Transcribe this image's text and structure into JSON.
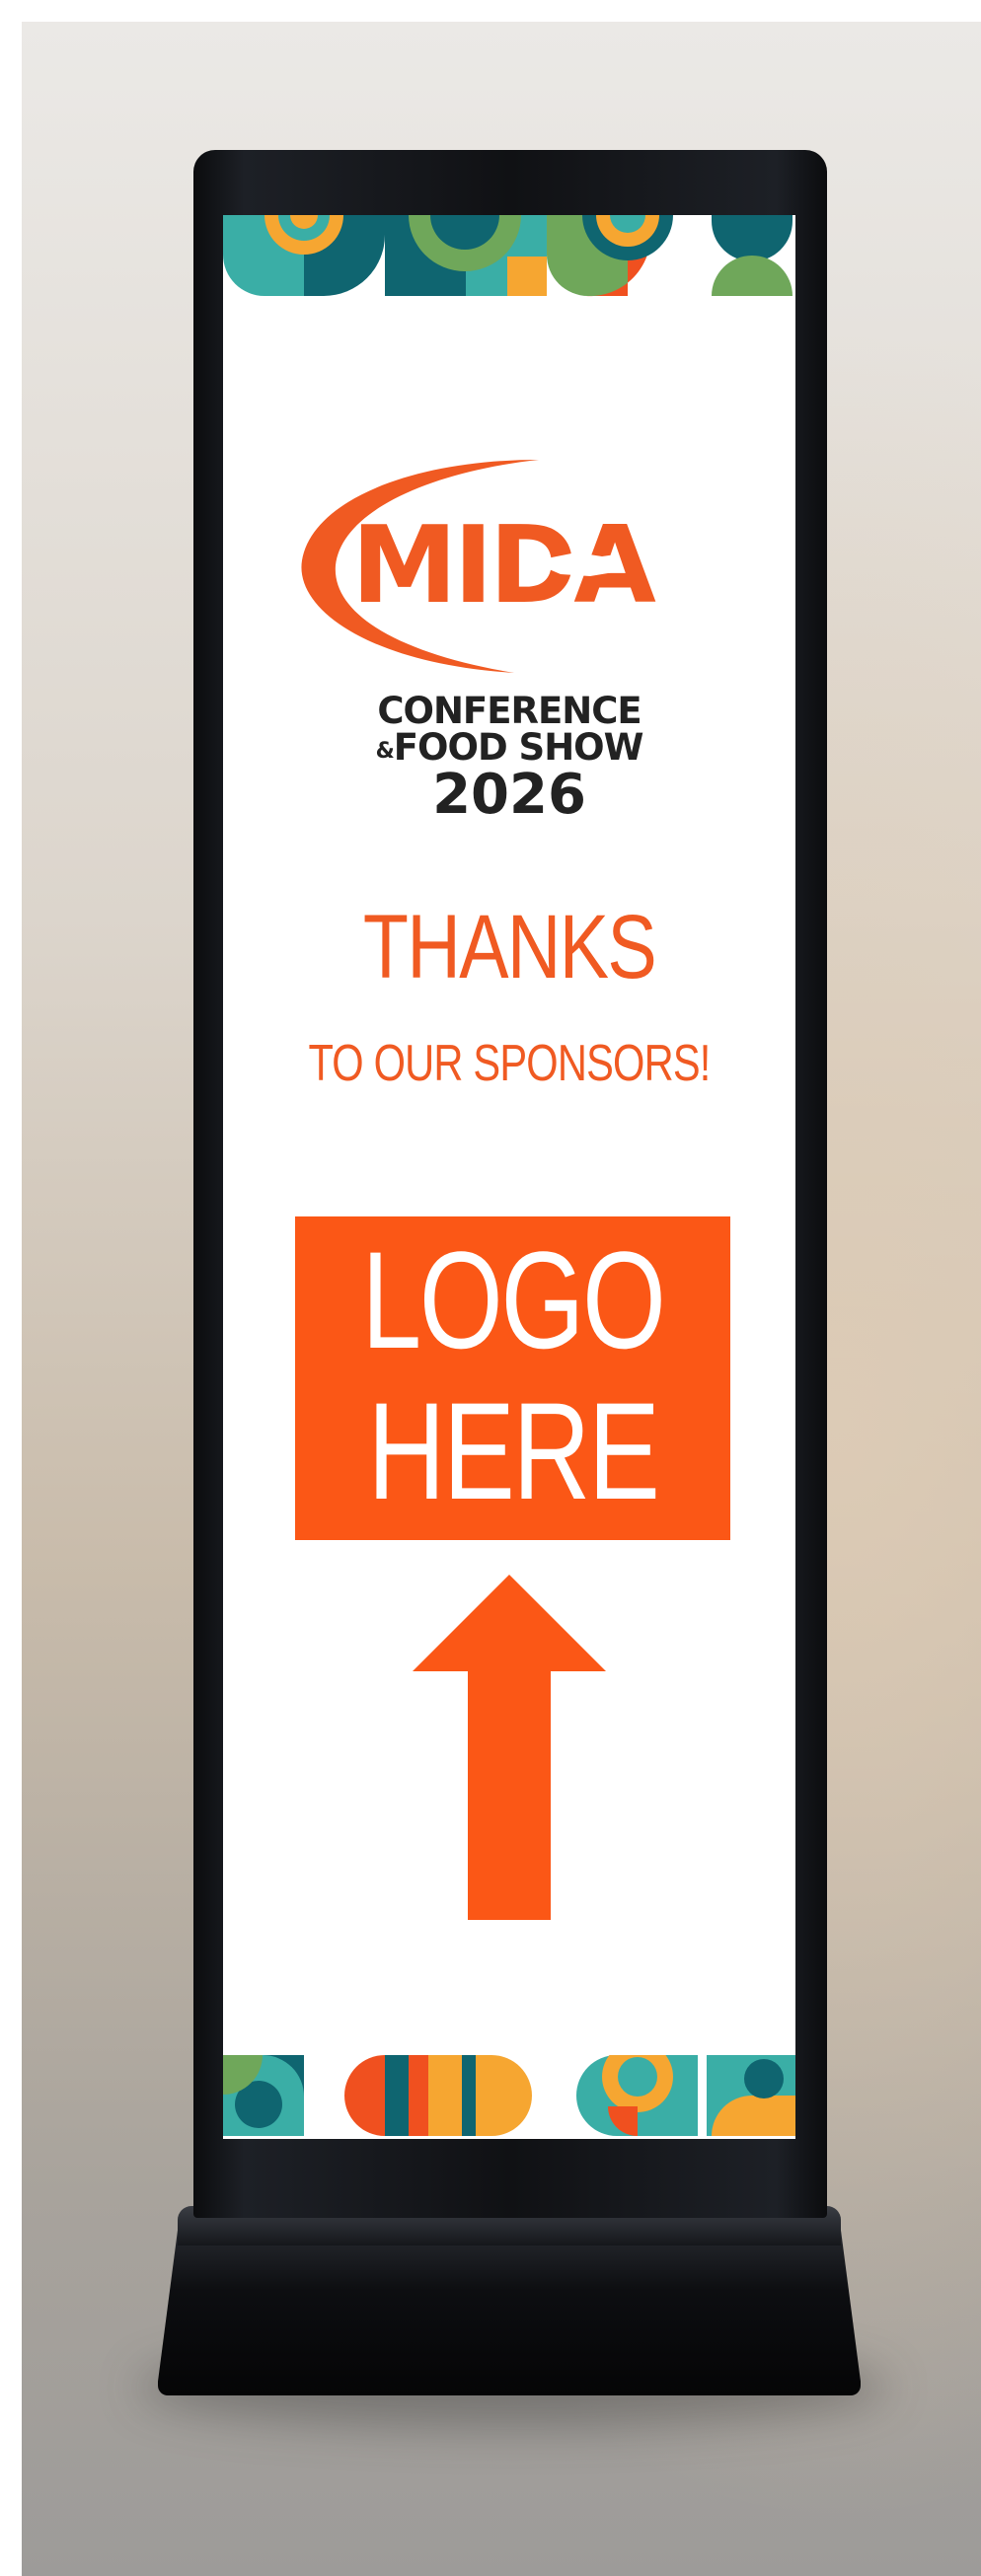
{
  "brand": {
    "logo_text": "MIDA",
    "line1": "CONFERENCE",
    "line2_amp": "&",
    "line2": "FOOD SHOW",
    "year": "2026"
  },
  "banner": {
    "headline": "THANKS",
    "subhead": "TO OUR SPONSORS!",
    "placeholder_line1": "LOGO",
    "placeholder_line2": "HERE"
  },
  "colors": {
    "orange": "#f05a22",
    "placeholder_orange": "#fb5716",
    "dark_text": "#222222",
    "teal": "#3aaea6",
    "dark_teal": "#0f6570",
    "green": "#6fa75a",
    "yellow": "#f6a631",
    "red_orange": "#f0501f"
  },
  "icons": [
    "arrow-up-icon",
    "puerto-rico-map-icon"
  ]
}
